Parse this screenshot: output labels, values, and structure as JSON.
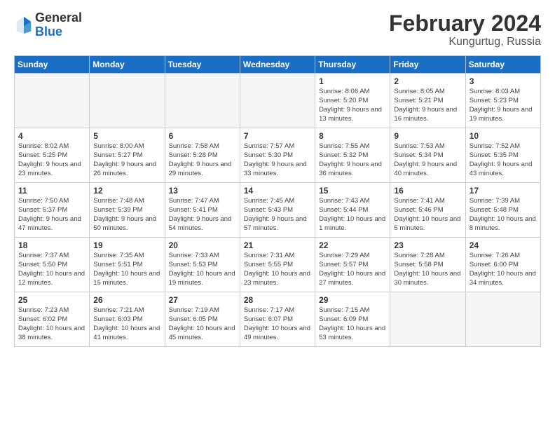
{
  "logo": {
    "general": "General",
    "blue": "Blue"
  },
  "header": {
    "title": "February 2024",
    "subtitle": "Kungurtug, Russia"
  },
  "weekdays": [
    "Sunday",
    "Monday",
    "Tuesday",
    "Wednesday",
    "Thursday",
    "Friday",
    "Saturday"
  ],
  "weeks": [
    [
      {
        "day": "",
        "empty": true
      },
      {
        "day": "",
        "empty": true
      },
      {
        "day": "",
        "empty": true
      },
      {
        "day": "",
        "empty": true
      },
      {
        "day": "1",
        "sunrise": "Sunrise: 8:06 AM",
        "sunset": "Sunset: 5:20 PM",
        "daylight": "Daylight: 9 hours and 13 minutes."
      },
      {
        "day": "2",
        "sunrise": "Sunrise: 8:05 AM",
        "sunset": "Sunset: 5:21 PM",
        "daylight": "Daylight: 9 hours and 16 minutes."
      },
      {
        "day": "3",
        "sunrise": "Sunrise: 8:03 AM",
        "sunset": "Sunset: 5:23 PM",
        "daylight": "Daylight: 9 hours and 19 minutes."
      }
    ],
    [
      {
        "day": "4",
        "sunrise": "Sunrise: 8:02 AM",
        "sunset": "Sunset: 5:25 PM",
        "daylight": "Daylight: 9 hours and 23 minutes."
      },
      {
        "day": "5",
        "sunrise": "Sunrise: 8:00 AM",
        "sunset": "Sunset: 5:27 PM",
        "daylight": "Daylight: 9 hours and 26 minutes."
      },
      {
        "day": "6",
        "sunrise": "Sunrise: 7:58 AM",
        "sunset": "Sunset: 5:28 PM",
        "daylight": "Daylight: 9 hours and 29 minutes."
      },
      {
        "day": "7",
        "sunrise": "Sunrise: 7:57 AM",
        "sunset": "Sunset: 5:30 PM",
        "daylight": "Daylight: 9 hours and 33 minutes."
      },
      {
        "day": "8",
        "sunrise": "Sunrise: 7:55 AM",
        "sunset": "Sunset: 5:32 PM",
        "daylight": "Daylight: 9 hours and 36 minutes."
      },
      {
        "day": "9",
        "sunrise": "Sunrise: 7:53 AM",
        "sunset": "Sunset: 5:34 PM",
        "daylight": "Daylight: 9 hours and 40 minutes."
      },
      {
        "day": "10",
        "sunrise": "Sunrise: 7:52 AM",
        "sunset": "Sunset: 5:35 PM",
        "daylight": "Daylight: 9 hours and 43 minutes."
      }
    ],
    [
      {
        "day": "11",
        "sunrise": "Sunrise: 7:50 AM",
        "sunset": "Sunset: 5:37 PM",
        "daylight": "Daylight: 9 hours and 47 minutes."
      },
      {
        "day": "12",
        "sunrise": "Sunrise: 7:48 AM",
        "sunset": "Sunset: 5:39 PM",
        "daylight": "Daylight: 9 hours and 50 minutes."
      },
      {
        "day": "13",
        "sunrise": "Sunrise: 7:47 AM",
        "sunset": "Sunset: 5:41 PM",
        "daylight": "Daylight: 9 hours and 54 minutes."
      },
      {
        "day": "14",
        "sunrise": "Sunrise: 7:45 AM",
        "sunset": "Sunset: 5:43 PM",
        "daylight": "Daylight: 9 hours and 57 minutes."
      },
      {
        "day": "15",
        "sunrise": "Sunrise: 7:43 AM",
        "sunset": "Sunset: 5:44 PM",
        "daylight": "Daylight: 10 hours and 1 minute."
      },
      {
        "day": "16",
        "sunrise": "Sunrise: 7:41 AM",
        "sunset": "Sunset: 5:46 PM",
        "daylight": "Daylight: 10 hours and 5 minutes."
      },
      {
        "day": "17",
        "sunrise": "Sunrise: 7:39 AM",
        "sunset": "Sunset: 5:48 PM",
        "daylight": "Daylight: 10 hours and 8 minutes."
      }
    ],
    [
      {
        "day": "18",
        "sunrise": "Sunrise: 7:37 AM",
        "sunset": "Sunset: 5:50 PM",
        "daylight": "Daylight: 10 hours and 12 minutes."
      },
      {
        "day": "19",
        "sunrise": "Sunrise: 7:35 AM",
        "sunset": "Sunset: 5:51 PM",
        "daylight": "Daylight: 10 hours and 15 minutes."
      },
      {
        "day": "20",
        "sunrise": "Sunrise: 7:33 AM",
        "sunset": "Sunset: 5:53 PM",
        "daylight": "Daylight: 10 hours and 19 minutes."
      },
      {
        "day": "21",
        "sunrise": "Sunrise: 7:31 AM",
        "sunset": "Sunset: 5:55 PM",
        "daylight": "Daylight: 10 hours and 23 minutes."
      },
      {
        "day": "22",
        "sunrise": "Sunrise: 7:29 AM",
        "sunset": "Sunset: 5:57 PM",
        "daylight": "Daylight: 10 hours and 27 minutes."
      },
      {
        "day": "23",
        "sunrise": "Sunrise: 7:28 AM",
        "sunset": "Sunset: 5:58 PM",
        "daylight": "Daylight: 10 hours and 30 minutes."
      },
      {
        "day": "24",
        "sunrise": "Sunrise: 7:26 AM",
        "sunset": "Sunset: 6:00 PM",
        "daylight": "Daylight: 10 hours and 34 minutes."
      }
    ],
    [
      {
        "day": "25",
        "sunrise": "Sunrise: 7:23 AM",
        "sunset": "Sunset: 6:02 PM",
        "daylight": "Daylight: 10 hours and 38 minutes."
      },
      {
        "day": "26",
        "sunrise": "Sunrise: 7:21 AM",
        "sunset": "Sunset: 6:03 PM",
        "daylight": "Daylight: 10 hours and 41 minutes."
      },
      {
        "day": "27",
        "sunrise": "Sunrise: 7:19 AM",
        "sunset": "Sunset: 6:05 PM",
        "daylight": "Daylight: 10 hours and 45 minutes."
      },
      {
        "day": "28",
        "sunrise": "Sunrise: 7:17 AM",
        "sunset": "Sunset: 6:07 PM",
        "daylight": "Daylight: 10 hours and 49 minutes."
      },
      {
        "day": "29",
        "sunrise": "Sunrise: 7:15 AM",
        "sunset": "Sunset: 6:09 PM",
        "daylight": "Daylight: 10 hours and 53 minutes."
      },
      {
        "day": "",
        "empty": true
      },
      {
        "day": "",
        "empty": true
      }
    ]
  ]
}
